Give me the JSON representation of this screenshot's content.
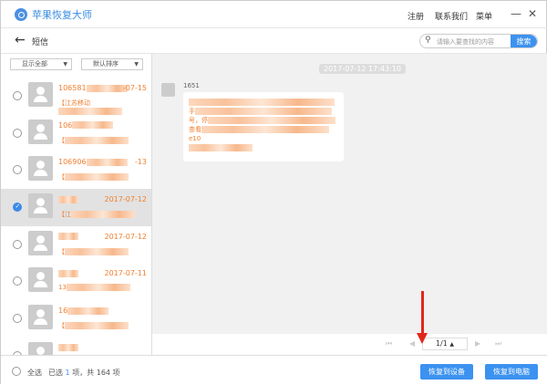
{
  "app": {
    "title": "苹果恢复大师",
    "menu": [
      "注册",
      "联系我们",
      "菜单"
    ],
    "minimize": "—",
    "close": "✕"
  },
  "header": {
    "title": "短信",
    "search_placeholder": "请输入要查找的内容",
    "search_button": "搜索"
  },
  "filters": {
    "show": "显示全部",
    "sort": "默认排序"
  },
  "conversations": [
    {
      "title": "106581",
      "date": "-07-15",
      "preview": "【江苏移动",
      "selected": false
    },
    {
      "title": "106",
      "date": "",
      "preview": "【",
      "selected": false
    },
    {
      "title": "106906",
      "date": "-13",
      "preview": "【",
      "selected": false
    },
    {
      "title": "",
      "date": "2017-07-12",
      "preview": "【江",
      "selected": true
    },
    {
      "title": "",
      "date": "2017-07-12",
      "preview": "【",
      "selected": false
    },
    {
      "title": "",
      "date": "2017-07-11",
      "preview": "13",
      "selected": false
    },
    {
      "title": "16",
      "date": "",
      "preview": "【",
      "selected": false
    },
    {
      "title": "",
      "date": "",
      "preview": "",
      "selected": false
    }
  ],
  "message": {
    "timestamp": "2017-07-12 17:43:10",
    "sender": "1651",
    "lines": [
      "",
      "手",
      "号，停",
      "查看",
      "e10",
      ""
    ]
  },
  "pager": {
    "first": "⏮",
    "prev": "◀",
    "page": "1/1",
    "up": "▲",
    "next": "▶",
    "last": "⏭"
  },
  "footer": {
    "select_all": "全选",
    "selected_prefix": "已选",
    "selected_count": "1",
    "selected_suffix": "项，共 164 项",
    "restore_device": "恢复到设备",
    "restore_pc": "恢复到电脑"
  },
  "colors": {
    "accent": "#3c92f0",
    "highlight": "#f08030"
  }
}
